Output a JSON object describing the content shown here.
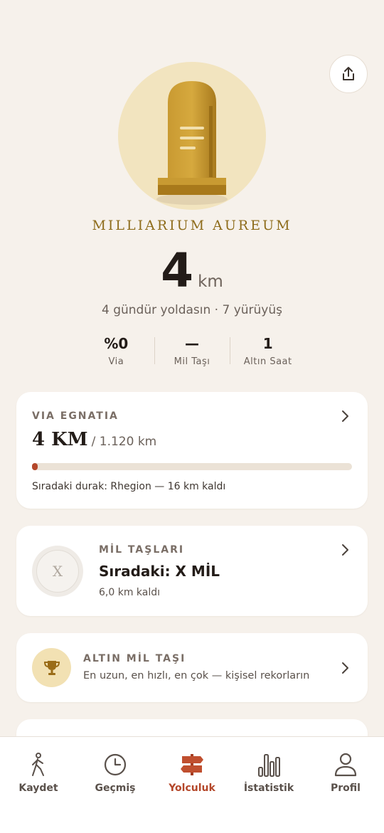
{
  "header": {
    "title": "MILLIARIUM AUREUM",
    "distance_value": "4",
    "distance_unit": "km",
    "subtitle": "4 gündür yoldasın · 7 yürüyüş"
  },
  "icons": {
    "share": "share-icon",
    "hero": "milestone-icon"
  },
  "stats": [
    {
      "value": "%0",
      "label": "Via"
    },
    {
      "value": "—",
      "label": "Mil Taşı"
    },
    {
      "value": "1",
      "label": "Altın Saat"
    }
  ],
  "via_card": {
    "kicker": "VIA EGNATIA",
    "current": "4 KM",
    "total": "/ 1.120 km",
    "progress": 0.004,
    "next_stop": "Sıradaki durak: Rhegion — 16 km kaldı"
  },
  "milestone_card": {
    "kicker": "MİL TAŞLARI",
    "badge": "X",
    "title": "Sıradaki: X MİL",
    "remaining": "6,0 km kaldı"
  },
  "gold_card": {
    "kicker": "ALTIN MİL TAŞI",
    "description": "En uzun, en hızlı, en çok — kişisel rekorların"
  },
  "nav": [
    {
      "label": "Kaydet",
      "icon": "walk-icon",
      "active": false
    },
    {
      "label": "Geçmiş",
      "icon": "clock-icon",
      "active": false
    },
    {
      "label": "Yolculuk",
      "icon": "signpost-icon",
      "active": true
    },
    {
      "label": "İstatistik",
      "icon": "bar-chart-icon",
      "active": false
    },
    {
      "label": "Profil",
      "icon": "user-icon",
      "active": false
    }
  ],
  "colors": {
    "accent": "#b4472a",
    "gold": "#b8922e",
    "background": "#f6f1eb"
  }
}
